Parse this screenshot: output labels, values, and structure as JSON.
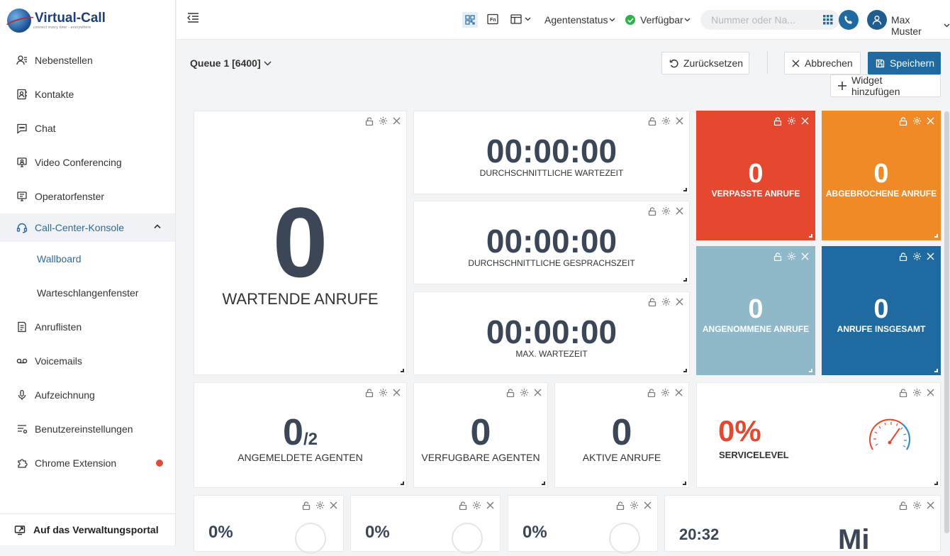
{
  "brand": {
    "logo_text": "Virtual-Call",
    "logo_tagline": "connect every time - everywhere"
  },
  "sidebar": {
    "items": [
      {
        "label": "Nebenstellen",
        "icon": "extensions-icon"
      },
      {
        "label": "Kontakte",
        "icon": "contacts-icon"
      },
      {
        "label": "Chat",
        "icon": "chat-icon"
      },
      {
        "label": "Video Conferencing",
        "icon": "video-icon"
      },
      {
        "label": "Operatorfenster",
        "icon": "operator-icon"
      },
      {
        "label": "Call-Center-Konsole",
        "icon": "headset-icon"
      },
      {
        "label": "Anruflisten",
        "icon": "calllist-icon"
      },
      {
        "label": "Voicemails",
        "icon": "voicemail-icon"
      },
      {
        "label": "Aufzeichnung",
        "icon": "microphone-icon"
      },
      {
        "label": "Benutzereinstellungen",
        "icon": "settings-list-icon"
      },
      {
        "label": "Chrome Extension",
        "icon": "extension-puzzle-icon"
      }
    ],
    "sub_items": [
      {
        "label": "Wallboard"
      },
      {
        "label": "Warteschlangenfenster"
      }
    ],
    "portal_label": "Auf das Verwaltungsportal"
  },
  "topbar": {
    "agent_status_label": "Agentenstatus",
    "availability_label": "Verfügbar",
    "availability_color": "#2db34a",
    "search_placeholder": "Nummer oder Na...",
    "user_name": "Max Muster"
  },
  "toolbar": {
    "queue_label": "Queue 1 [6400]",
    "reset_label": "Zurücksetzen",
    "cancel_label": "Abbrechen",
    "save_label": "Speichern",
    "add_widget_label": "Widget hinzufügen"
  },
  "widgets": {
    "waiting_calls": {
      "value": "0",
      "label": "WARTENDE ANRUFE"
    },
    "avg_wait": {
      "value": "00:00:00",
      "label": "DURCHSCHNITTLICHE WARTEZEIT"
    },
    "avg_talk": {
      "value": "00:00:00",
      "label": "DURCHSCHNITTLICHE GESPRACHSZEIT"
    },
    "max_wait": {
      "value": "00:00:00",
      "label": "MAX. WARTEZEIT"
    },
    "missed": {
      "value": "0",
      "label": "VERPASSTE ANRUFE",
      "color": "#e5482f"
    },
    "abandoned": {
      "value": "0",
      "label": "ABGEBROCHENE ANRUFE",
      "color": "#ef8a26"
    },
    "answered": {
      "value": "0",
      "label": "ANGENOMMENE ANRUFE",
      "color": "#8fb8c9"
    },
    "total": {
      "value": "0",
      "label": "ANRUFE INSGESAMT",
      "color": "#1f6aa0"
    },
    "logged_agents": {
      "value": "0",
      "total": "/2",
      "label": "ANGEMELDETE AGENTEN"
    },
    "available_agents": {
      "value": "0",
      "label": "VERFUGBARE AGENTEN"
    },
    "active_calls": {
      "value": "0",
      "label": "AKTIVE ANRUFE"
    },
    "service_level": {
      "value": "0%",
      "label": "SERVICELEVEL",
      "color": "#e5482f"
    },
    "bottom_row": [
      {
        "value": "0%"
      },
      {
        "value": "0%"
      },
      {
        "value": "0%"
      },
      {
        "value": "20:32",
        "side": "Mi"
      }
    ]
  }
}
